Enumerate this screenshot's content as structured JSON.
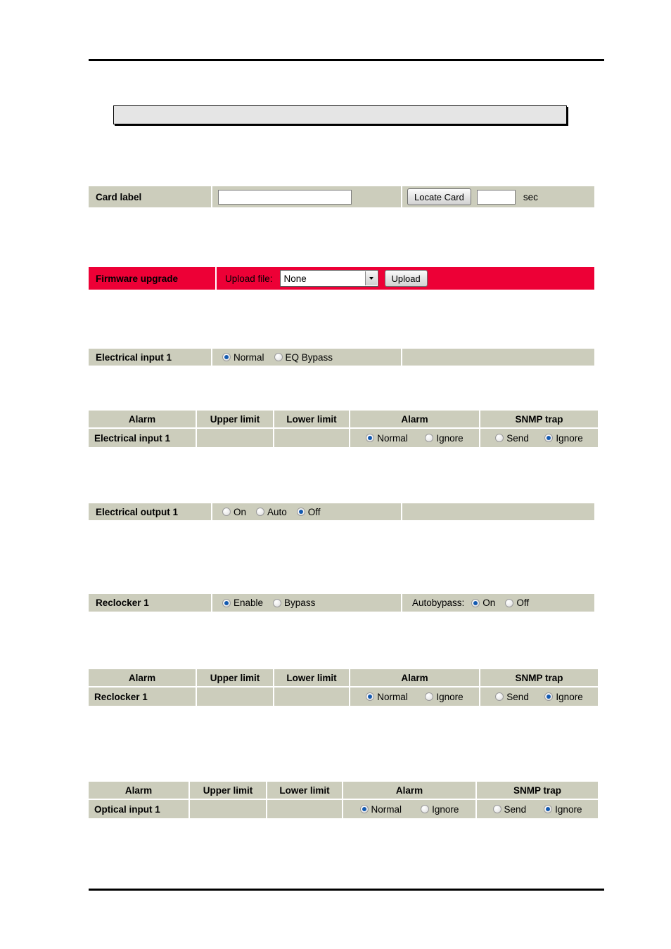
{
  "page": {
    "title_box_text": ""
  },
  "card_label_row": {
    "label": "Card label",
    "value": "",
    "locate_button": "Locate Card",
    "seconds_value": "",
    "seconds_unit": "sec"
  },
  "firmware_row": {
    "label": "Firmware upgrade",
    "upload_file_label": "Upload file:",
    "selected_file": "None",
    "upload_button": "Upload",
    "bar_color": "#ed0036"
  },
  "electrical_input_row": {
    "label": "Electrical input 1",
    "options": [
      {
        "label": "Normal",
        "selected": true
      },
      {
        "label": "EQ Bypass",
        "selected": false
      }
    ]
  },
  "electrical_output_row": {
    "label": "Electrical output 1",
    "options": [
      {
        "label": "On",
        "selected": false
      },
      {
        "label": "Auto",
        "selected": false
      },
      {
        "label": "Off",
        "selected": true
      }
    ]
  },
  "reclocker_row": {
    "label": "Reclocker 1",
    "options": [
      {
        "label": "Enable",
        "selected": true
      },
      {
        "label": "Bypass",
        "selected": false
      }
    ],
    "autobypass_label": "Autobypass:",
    "autobypass_options": [
      {
        "label": "On",
        "selected": true
      },
      {
        "label": "Off",
        "selected": false
      }
    ]
  },
  "alarm_table_headers": {
    "col1": "Alarm",
    "col2": "Upper limit",
    "col3": "Lower limit",
    "col4": "Alarm",
    "col5": "SNMP trap"
  },
  "alarm_tables": [
    {
      "id": "electrical-input-1",
      "name": "Electrical input 1",
      "upper_limit": "",
      "lower_limit": "",
      "alarm_options": [
        {
          "label": "Normal",
          "selected": true
        },
        {
          "label": "Ignore",
          "selected": false
        }
      ],
      "snmp_options": [
        {
          "label": "Send",
          "selected": false
        },
        {
          "label": "Ignore",
          "selected": true
        }
      ]
    },
    {
      "id": "reclocker-1",
      "name": "Reclocker 1",
      "upper_limit": "",
      "lower_limit": "",
      "alarm_options": [
        {
          "label": "Normal",
          "selected": true
        },
        {
          "label": "Ignore",
          "selected": false
        }
      ],
      "snmp_options": [
        {
          "label": "Send",
          "selected": false
        },
        {
          "label": "Ignore",
          "selected": true
        }
      ]
    },
    {
      "id": "optical-input-1",
      "name": "Optical input 1",
      "upper_limit": "",
      "lower_limit": "",
      "alarm_options": [
        {
          "label": "Normal",
          "selected": true
        },
        {
          "label": "Ignore",
          "selected": false
        }
      ],
      "snmp_options": [
        {
          "label": "Send",
          "selected": false
        },
        {
          "label": "Ignore",
          "selected": true
        }
      ]
    }
  ],
  "colors": {
    "panel_bg": "#cccdbc",
    "firmware_red": "#ed0036",
    "radio_selected": "#1259b0",
    "rule": "#000000",
    "topbox_bg": "#e5e5e5"
  }
}
